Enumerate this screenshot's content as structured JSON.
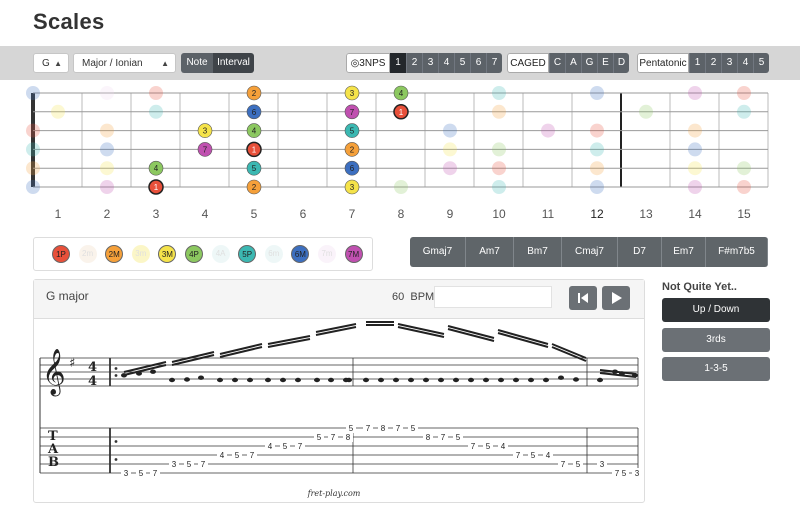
{
  "page_title": "Scales",
  "toolbar": {
    "key_select": "G",
    "scale_select": "Major / Ionian",
    "note_label": "Note",
    "interval_label": "Interval",
    "nps_label": "3NPS",
    "nps_positions": [
      "1",
      "2",
      "3",
      "4",
      "5",
      "6",
      "7"
    ],
    "caged_label": "CAGED",
    "caged_shapes": [
      "C",
      "A",
      "G",
      "E",
      "D"
    ],
    "pentatonic_label": "Pentatonic",
    "pentatonic_positions": [
      "1",
      "2",
      "3",
      "4",
      "5"
    ]
  },
  "fret_numbers": [
    "1",
    "2",
    "3",
    "4",
    "5",
    "6",
    "7",
    "8",
    "9",
    "10",
    "11",
    "12",
    "13",
    "14",
    "15"
  ],
  "colors": {
    "1": "#e8503a",
    "2": "#f5a03a",
    "3": "#f5e34a",
    "4": "#8cc860",
    "5": "#3bb8b2",
    "6": "#3c6fc0",
    "7": "#c050b0",
    "b3": "#f0d8c0",
    "b5": "#c8e8e8",
    "b6": "#c8d8f0",
    "b7": "#f0d8f0"
  },
  "fretboard_notes": [
    {
      "s": 1,
      "f": 5,
      "label": "2",
      "deg": "2"
    },
    {
      "s": 1,
      "f": 7,
      "label": "3",
      "deg": "3"
    },
    {
      "s": 1,
      "f": 8,
      "label": "4",
      "deg": "4"
    },
    {
      "s": 2,
      "f": 5,
      "label": "6",
      "deg": "6"
    },
    {
      "s": 2,
      "f": 7,
      "label": "7",
      "deg": "7"
    },
    {
      "s": 2,
      "f": 8,
      "label": "1",
      "deg": "1"
    },
    {
      "s": 3,
      "f": 4,
      "label": "3",
      "deg": "3"
    },
    {
      "s": 3,
      "f": 5,
      "label": "4",
      "deg": "4"
    },
    {
      "s": 3,
      "f": 7,
      "label": "5",
      "deg": "5"
    },
    {
      "s": 4,
      "f": 4,
      "label": "7",
      "deg": "7"
    },
    {
      "s": 4,
      "f": 5,
      "label": "1",
      "deg": "1"
    },
    {
      "s": 4,
      "f": 7,
      "label": "2",
      "deg": "2"
    },
    {
      "s": 5,
      "f": 3,
      "label": "4",
      "deg": "4"
    },
    {
      "s": 5,
      "f": 5,
      "label": "5",
      "deg": "5"
    },
    {
      "s": 5,
      "f": 7,
      "label": "6",
      "deg": "6"
    },
    {
      "s": 6,
      "f": 3,
      "label": "1",
      "deg": "1"
    },
    {
      "s": 6,
      "f": 5,
      "label": "2",
      "deg": "2"
    },
    {
      "s": 6,
      "f": 7,
      "label": "3",
      "deg": "3"
    }
  ],
  "fretboard_faded": [
    {
      "s": 1,
      "f": 0,
      "deg": "6"
    },
    {
      "s": 1,
      "f": 2,
      "deg": "b7"
    },
    {
      "s": 1,
      "f": 3,
      "deg": "1"
    },
    {
      "s": 1,
      "f": 10,
      "deg": "5"
    },
    {
      "s": 1,
      "f": 12,
      "deg": "6"
    },
    {
      "s": 1,
      "f": 14,
      "deg": "7"
    },
    {
      "s": 1,
      "f": 15,
      "deg": "1"
    },
    {
      "s": 2,
      "f": 1,
      "deg": "3"
    },
    {
      "s": 2,
      "f": 3,
      "deg": "5"
    },
    {
      "s": 2,
      "f": 10,
      "deg": "2"
    },
    {
      "s": 2,
      "f": 13,
      "deg": "4"
    },
    {
      "s": 2,
      "f": 15,
      "deg": "5"
    },
    {
      "s": 3,
      "f": 0,
      "deg": "1"
    },
    {
      "s": 3,
      "f": 2,
      "deg": "2"
    },
    {
      "s": 3,
      "f": 9,
      "deg": "6"
    },
    {
      "s": 3,
      "f": 11,
      "deg": "7"
    },
    {
      "s": 3,
      "f": 12,
      "deg": "1"
    },
    {
      "s": 3,
      "f": 14,
      "deg": "2"
    },
    {
      "s": 4,
      "f": 0,
      "deg": "5"
    },
    {
      "s": 4,
      "f": 2,
      "deg": "6"
    },
    {
      "s": 4,
      "f": 9,
      "deg": "3"
    },
    {
      "s": 4,
      "f": 10,
      "deg": "4"
    },
    {
      "s": 4,
      "f": 12,
      "deg": "5"
    },
    {
      "s": 4,
      "f": 14,
      "deg": "6"
    },
    {
      "s": 5,
      "f": 0,
      "deg": "2"
    },
    {
      "s": 5,
      "f": 2,
      "deg": "3"
    },
    {
      "s": 5,
      "f": 9,
      "deg": "7"
    },
    {
      "s": 5,
      "f": 10,
      "deg": "1"
    },
    {
      "s": 5,
      "f": 12,
      "deg": "2"
    },
    {
      "s": 5,
      "f": 14,
      "deg": "3"
    },
    {
      "s": 5,
      "f": 15,
      "deg": "4"
    },
    {
      "s": 6,
      "f": 0,
      "deg": "6"
    },
    {
      "s": 6,
      "f": 2,
      "deg": "7"
    },
    {
      "s": 6,
      "f": 8,
      "deg": "4"
    },
    {
      "s": 6,
      "f": 10,
      "deg": "5"
    },
    {
      "s": 6,
      "f": 12,
      "deg": "6"
    },
    {
      "s": 6,
      "f": 14,
      "deg": "7"
    },
    {
      "s": 6,
      "f": 15,
      "deg": "1"
    }
  ],
  "legend": [
    {
      "label": "1P",
      "deg": "1",
      "active": true
    },
    {
      "label": "2m",
      "deg": "b3",
      "active": false
    },
    {
      "label": "2M",
      "deg": "2",
      "active": true
    },
    {
      "label": "3m",
      "deg": "3",
      "active": false
    },
    {
      "label": "3M",
      "deg": "3",
      "active": true
    },
    {
      "label": "4P",
      "deg": "4",
      "active": true
    },
    {
      "label": "4A",
      "deg": "b5",
      "active": false
    },
    {
      "label": "5P",
      "deg": "5",
      "active": true
    },
    {
      "label": "6m",
      "deg": "b5",
      "active": false
    },
    {
      "label": "6M",
      "deg": "6",
      "active": true
    },
    {
      "label": "7m",
      "deg": "b7",
      "active": false
    },
    {
      "label": "7M",
      "deg": "7",
      "active": true
    }
  ],
  "chords": [
    "Gmaj7",
    "Am7",
    "Bm7",
    "Cmaj7",
    "D7",
    "Em7",
    "F#m7b5"
  ],
  "player": {
    "title": "G major",
    "bpm_value": "60",
    "bpm_label": "BPM",
    "footer": "fret-play.com",
    "time_signature": [
      "4",
      "4"
    ],
    "tab_clef": [
      "T",
      "A",
      "B"
    ]
  },
  "tab_notes": [
    {
      "s": 6,
      "t": "3"
    },
    {
      "s": 6,
      "t": "5"
    },
    {
      "s": 6,
      "t": "7"
    },
    {
      "s": 5,
      "t": "3"
    },
    {
      "s": 5,
      "t": "5"
    },
    {
      "s": 5,
      "t": "7"
    },
    {
      "s": 4,
      "t": "4"
    },
    {
      "s": 4,
      "t": "5"
    },
    {
      "s": 4,
      "t": "7"
    },
    {
      "s": 3,
      "t": "4"
    },
    {
      "s": 3,
      "t": "5"
    },
    {
      "s": 3,
      "t": "7"
    },
    {
      "s": 2,
      "t": "5"
    },
    {
      "s": 2,
      "t": "7"
    },
    {
      "s": 2,
      "t": "8"
    },
    {
      "s": 1,
      "t": "5"
    },
    {
      "s": 1,
      "t": "7"
    },
    {
      "s": 1,
      "t": "8"
    },
    {
      "s": 1,
      "t": "7"
    },
    {
      "s": 1,
      "t": "5"
    },
    {
      "s": 2,
      "t": "8"
    },
    {
      "s": 2,
      "t": "7"
    },
    {
      "s": 2,
      "t": "5"
    },
    {
      "s": 3,
      "t": "7"
    },
    {
      "s": 3,
      "t": "5"
    },
    {
      "s": 3,
      "t": "4"
    },
    {
      "s": 4,
      "t": "7"
    },
    {
      "s": 4,
      "t": "5"
    },
    {
      "s": 4,
      "t": "4"
    },
    {
      "s": 5,
      "t": "7"
    },
    {
      "s": 5,
      "t": "5"
    },
    {
      "s": 5,
      "t": "3"
    },
    {
      "s": 6,
      "t": "7"
    },
    {
      "s": 6,
      "t": "5"
    },
    {
      "s": 6,
      "t": "3"
    }
  ],
  "sidebar": {
    "heading": "Not Quite Yet..",
    "buttons": [
      "Up / Down",
      "3rds",
      "1-3-5"
    ]
  }
}
